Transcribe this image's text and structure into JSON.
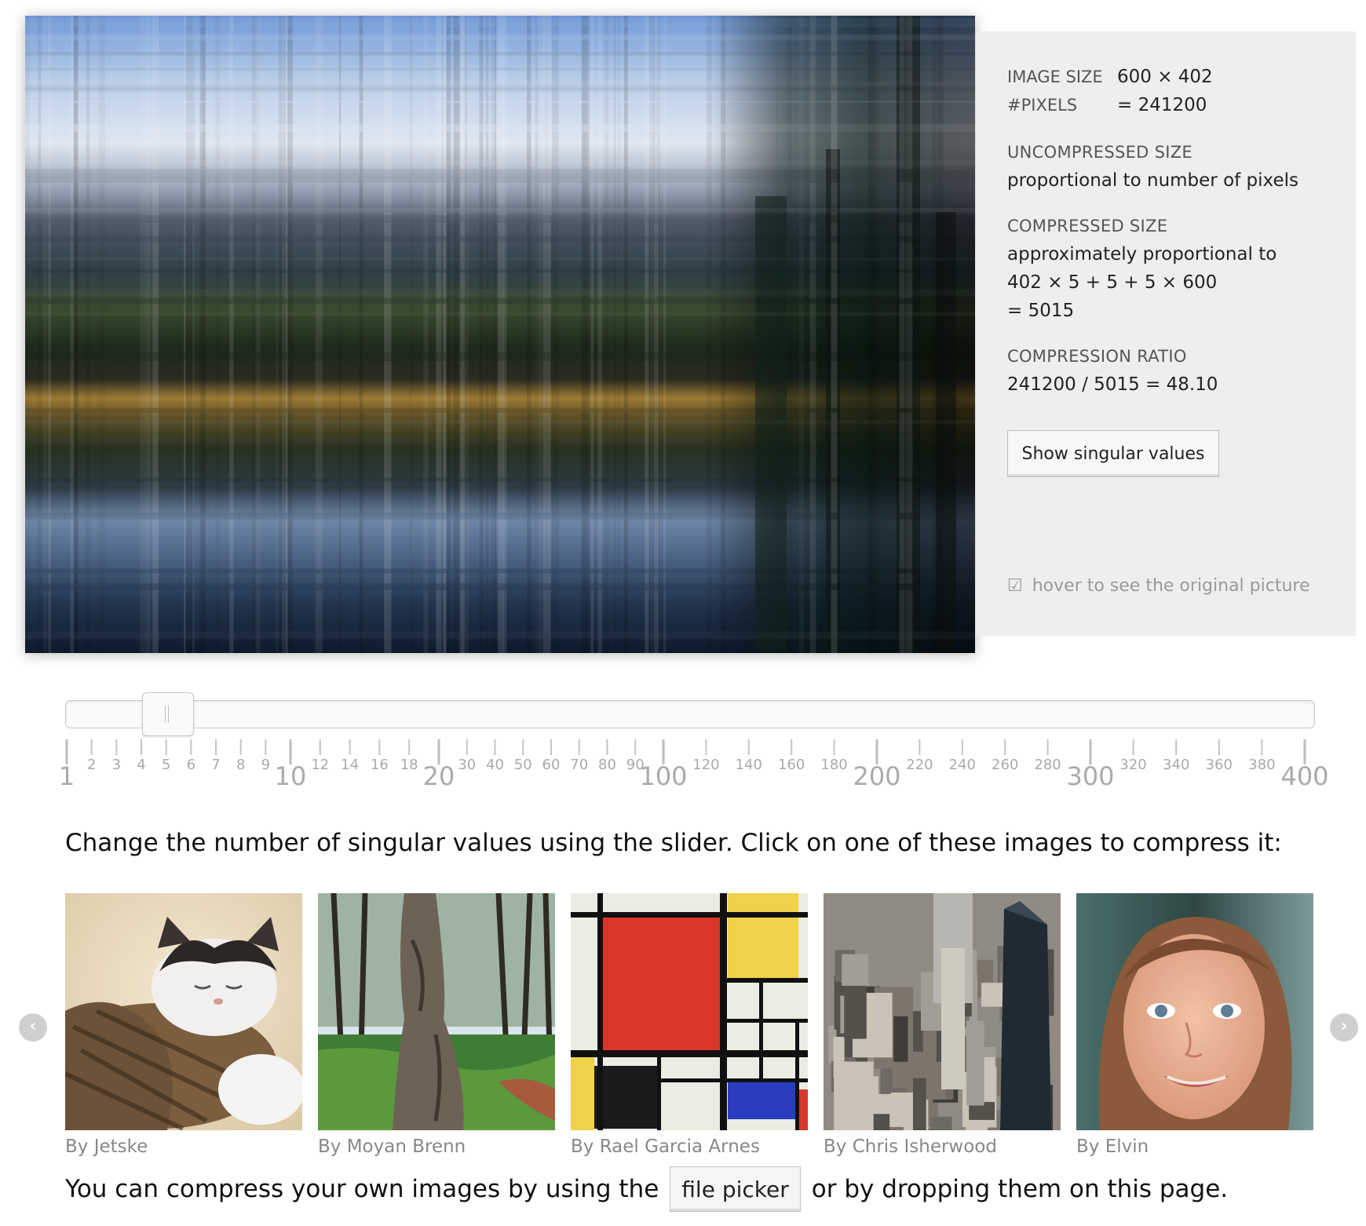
{
  "info": {
    "image_size_label": "IMAGE SIZE",
    "image_size_value": "600 × 402",
    "pixels_label": "#PIXELS",
    "pixels_value": "= 241200",
    "uncompressed_label": "UNCOMPRESSED SIZE",
    "uncompressed_value": "proportional to number of pixels",
    "compressed_label": "COMPRESSED SIZE",
    "compressed_line1": "approximately proportional to",
    "compressed_line2": "402 × 5 + 5 + 5 × 600",
    "compressed_line3": "= 5015",
    "ratio_label": "COMPRESSION RATIO",
    "ratio_value": "241200 / 5015 = 48.10",
    "show_button": "Show singular values",
    "hover_checkbox": "☑",
    "hover_text": "hover to see the original picture"
  },
  "slider": {
    "value": 5,
    "min": 1,
    "max": 400,
    "major_labels": [
      "1",
      "10",
      "20",
      "100",
      "200",
      "300",
      "400"
    ],
    "minor_labels": [
      "2",
      "3",
      "4",
      "5",
      "6",
      "7",
      "8",
      "9",
      "12",
      "14",
      "16",
      "18",
      "30",
      "40",
      "50",
      "60",
      "70",
      "80",
      "90",
      "120",
      "140",
      "160",
      "180",
      "220",
      "240",
      "260",
      "280",
      "320",
      "340",
      "360",
      "380"
    ]
  },
  "instructions": "Change the number of singular values using the slider. Click on one of these images to compress it:",
  "gallery": [
    {
      "credit": "By Jetske",
      "icon": "kitten-photo"
    },
    {
      "credit": "By Moyan Brenn",
      "icon": "forest-photo"
    },
    {
      "credit": "By Rael Garcia Arnes",
      "icon": "mondrian-painting"
    },
    {
      "credit": "By Chris Isherwood",
      "icon": "city-photo"
    },
    {
      "credit": "By Elvin",
      "icon": "girl-portrait"
    }
  ],
  "nav": {
    "prev_symbol": "‹",
    "next_symbol": "›"
  },
  "footer": {
    "before": "You can compress your own images by using the",
    "button": "file picker",
    "after": "or by dropping them on this page."
  },
  "colors": {
    "panel": "#eeeeee",
    "muted": "#888888"
  }
}
